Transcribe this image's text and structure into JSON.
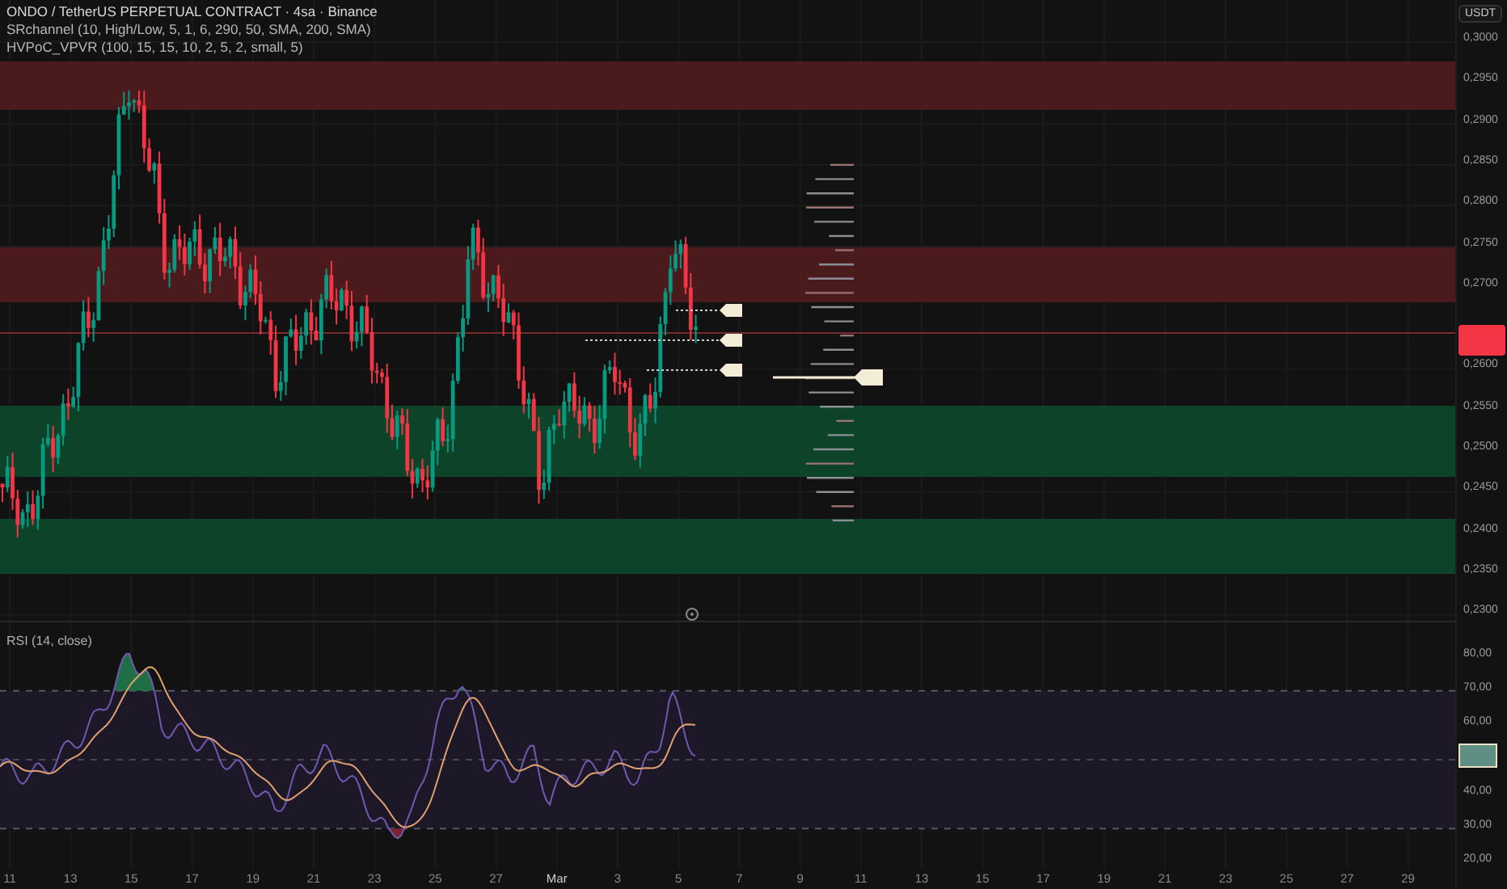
{
  "legend": [
    "ONDO / TetherUS PERPETUAL CONTRACT · 4sa · Binance",
    "SRchannel (10, High/Low, 5, 1, 6, 290, 50, SMA, 200, SMA)",
    "HVPoC_VPVR (100, 15, 15, 10, 2, 5, 2, small, 5)"
  ],
  "price_axis": {
    "unit": "USDT",
    "ticks": [
      "0,3000",
      "0,2950",
      "0,2900",
      "0,2850",
      "0,2800",
      "0,2750",
      "0,2700",
      "0,2600",
      "0,2550",
      "0,2500",
      "0,2450",
      "0,2400",
      "0,2350",
      "0,2300"
    ]
  },
  "rsi": {
    "legend": "RSI (14, close)",
    "ticks": [
      "80,00",
      "70,00",
      "60,00",
      "40,00",
      "30,00",
      "20,00"
    ]
  },
  "time_axis": {
    "ticks": [
      {
        "label": "11",
        "kind": "day"
      },
      {
        "label": "13",
        "kind": "day"
      },
      {
        "label": "15",
        "kind": "day"
      },
      {
        "label": "17",
        "kind": "day"
      },
      {
        "label": "19",
        "kind": "day"
      },
      {
        "label": "21",
        "kind": "day"
      },
      {
        "label": "23",
        "kind": "day"
      },
      {
        "label": "25",
        "kind": "day"
      },
      {
        "label": "27",
        "kind": "day"
      },
      {
        "label": "Mar",
        "kind": "month"
      },
      {
        "label": "3",
        "kind": "day"
      },
      {
        "label": "5",
        "kind": "day"
      },
      {
        "label": "7",
        "kind": "day"
      },
      {
        "label": "9",
        "kind": "day"
      },
      {
        "label": "11",
        "kind": "day"
      },
      {
        "label": "13",
        "kind": "day"
      },
      {
        "label": "15",
        "kind": "day"
      },
      {
        "label": "17",
        "kind": "day"
      },
      {
        "label": "19",
        "kind": "day"
      },
      {
        "label": "21",
        "kind": "day"
      },
      {
        "label": "23",
        "kind": "day"
      },
      {
        "label": "25",
        "kind": "day"
      },
      {
        "label": "27",
        "kind": "day"
      },
      {
        "label": "29",
        "kind": "day"
      }
    ]
  }
}
